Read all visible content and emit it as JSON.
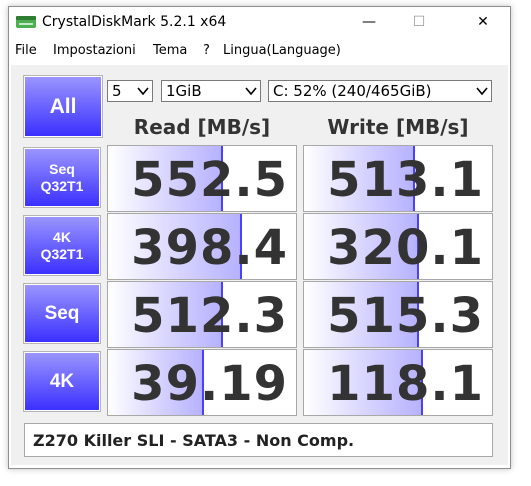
{
  "window": {
    "title": "CrystalDiskMark 5.2.1 x64"
  },
  "menu": [
    "File",
    "Impostazioni",
    "Tema",
    "?",
    "Lingua(Language)"
  ],
  "controls": {
    "all_label": "All",
    "count": "5",
    "size": "1GiB",
    "drive": "C: 52% (240/465GiB)"
  },
  "headers": {
    "read": "Read [MB/s]",
    "write": "Write [MB/s]"
  },
  "rows": [
    {
      "label1": "Seq",
      "label2": "Q32T1",
      "read": "552.5",
      "write": "513.1",
      "read_fill": 0.6,
      "write_fill": 0.58
    },
    {
      "label1": "4K",
      "label2": "Q32T1",
      "read": "398.4",
      "write": "320.1",
      "read_fill": 0.7,
      "write_fill": 0.6
    },
    {
      "label1": "Seq",
      "label2": "",
      "read": "512.3",
      "write": "515.3",
      "read_fill": 0.6,
      "write_fill": 0.6
    },
    {
      "label1": "4K",
      "label2": "",
      "read": "39.19",
      "write": "118.1",
      "read_fill": 0.5,
      "write_fill": 0.62
    }
  ],
  "comment": "Z270 Killer SLI - SATA3 - Non Comp.",
  "colors": {
    "accent": "#3b30ff",
    "bar_edge": "#4a40ff"
  }
}
